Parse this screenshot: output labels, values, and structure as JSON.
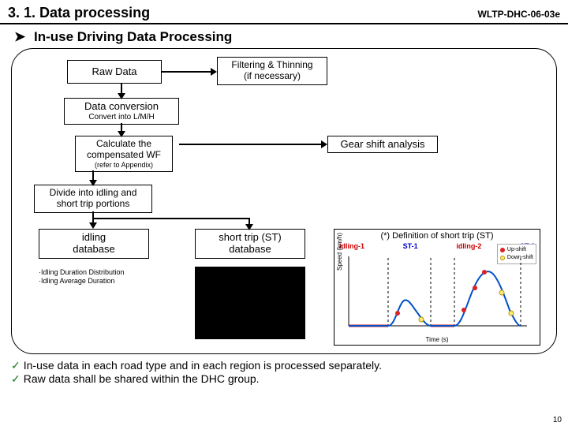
{
  "header": {
    "title": "3. 1. Data processing",
    "code": "WLTP-DHC-06-03e"
  },
  "subhead": {
    "marker": "➤",
    "text": "In-use Driving Data Processing"
  },
  "boxes": {
    "raw": "Raw Data",
    "filter_l1": "Filtering & Thinning",
    "filter_l2": "(if necessary)",
    "conv_title": "Data conversion",
    "conv_sub": "Convert into L/M/H",
    "calc_l1": "Calculate the",
    "calc_l2": "compensated WF",
    "calc_sub": "(refer to Appendix)",
    "gear": "Gear shift analysis",
    "divide_l1": "Divide into idling and",
    "divide_l2": "short trip portions",
    "idling_l1": "idling",
    "idling_l2": "database",
    "st_l1": "short trip (ST)",
    "st_l2": "database"
  },
  "idling_notes": {
    "a": "·Idling Duration Distribution",
    "b": "·Idling Average Duration"
  },
  "def": {
    "title": "(*) Definition of short trip (ST)",
    "labels": [
      "idling-1",
      "ST-1",
      "idling-2",
      "ST-2"
    ],
    "legend_up": "Up-shift",
    "legend_dn": "Down-shift",
    "ylabel": "Speed (km/h)",
    "xlabel": "Time (s)"
  },
  "chart_data": {
    "type": "line",
    "title": "(*) Definition of short trip (ST)",
    "xlabel": "Time (s)",
    "ylabel": "Speed (km/h)",
    "series": [
      {
        "name": "speed",
        "x": [
          0,
          10,
          20,
          28,
          36,
          44,
          52,
          60,
          70,
          80,
          90,
          100,
          108,
          116,
          124,
          132,
          140,
          148,
          156,
          164,
          172,
          180,
          188
        ],
        "y": [
          0,
          0,
          0,
          0,
          0,
          0,
          12,
          20,
          14,
          8,
          0,
          0,
          0,
          0,
          10,
          24,
          38,
          46,
          40,
          26,
          12,
          0,
          0
        ]
      }
    ],
    "annotations": [
      "idling-1",
      "ST-1",
      "idling-2",
      "ST-2"
    ],
    "ylim": [
      0,
      50
    ]
  },
  "bullets": {
    "a": "In-use data in each road type and in each region is processed separately.",
    "b": "Raw data shall be shared within the DHC group."
  },
  "pagenum": "10"
}
